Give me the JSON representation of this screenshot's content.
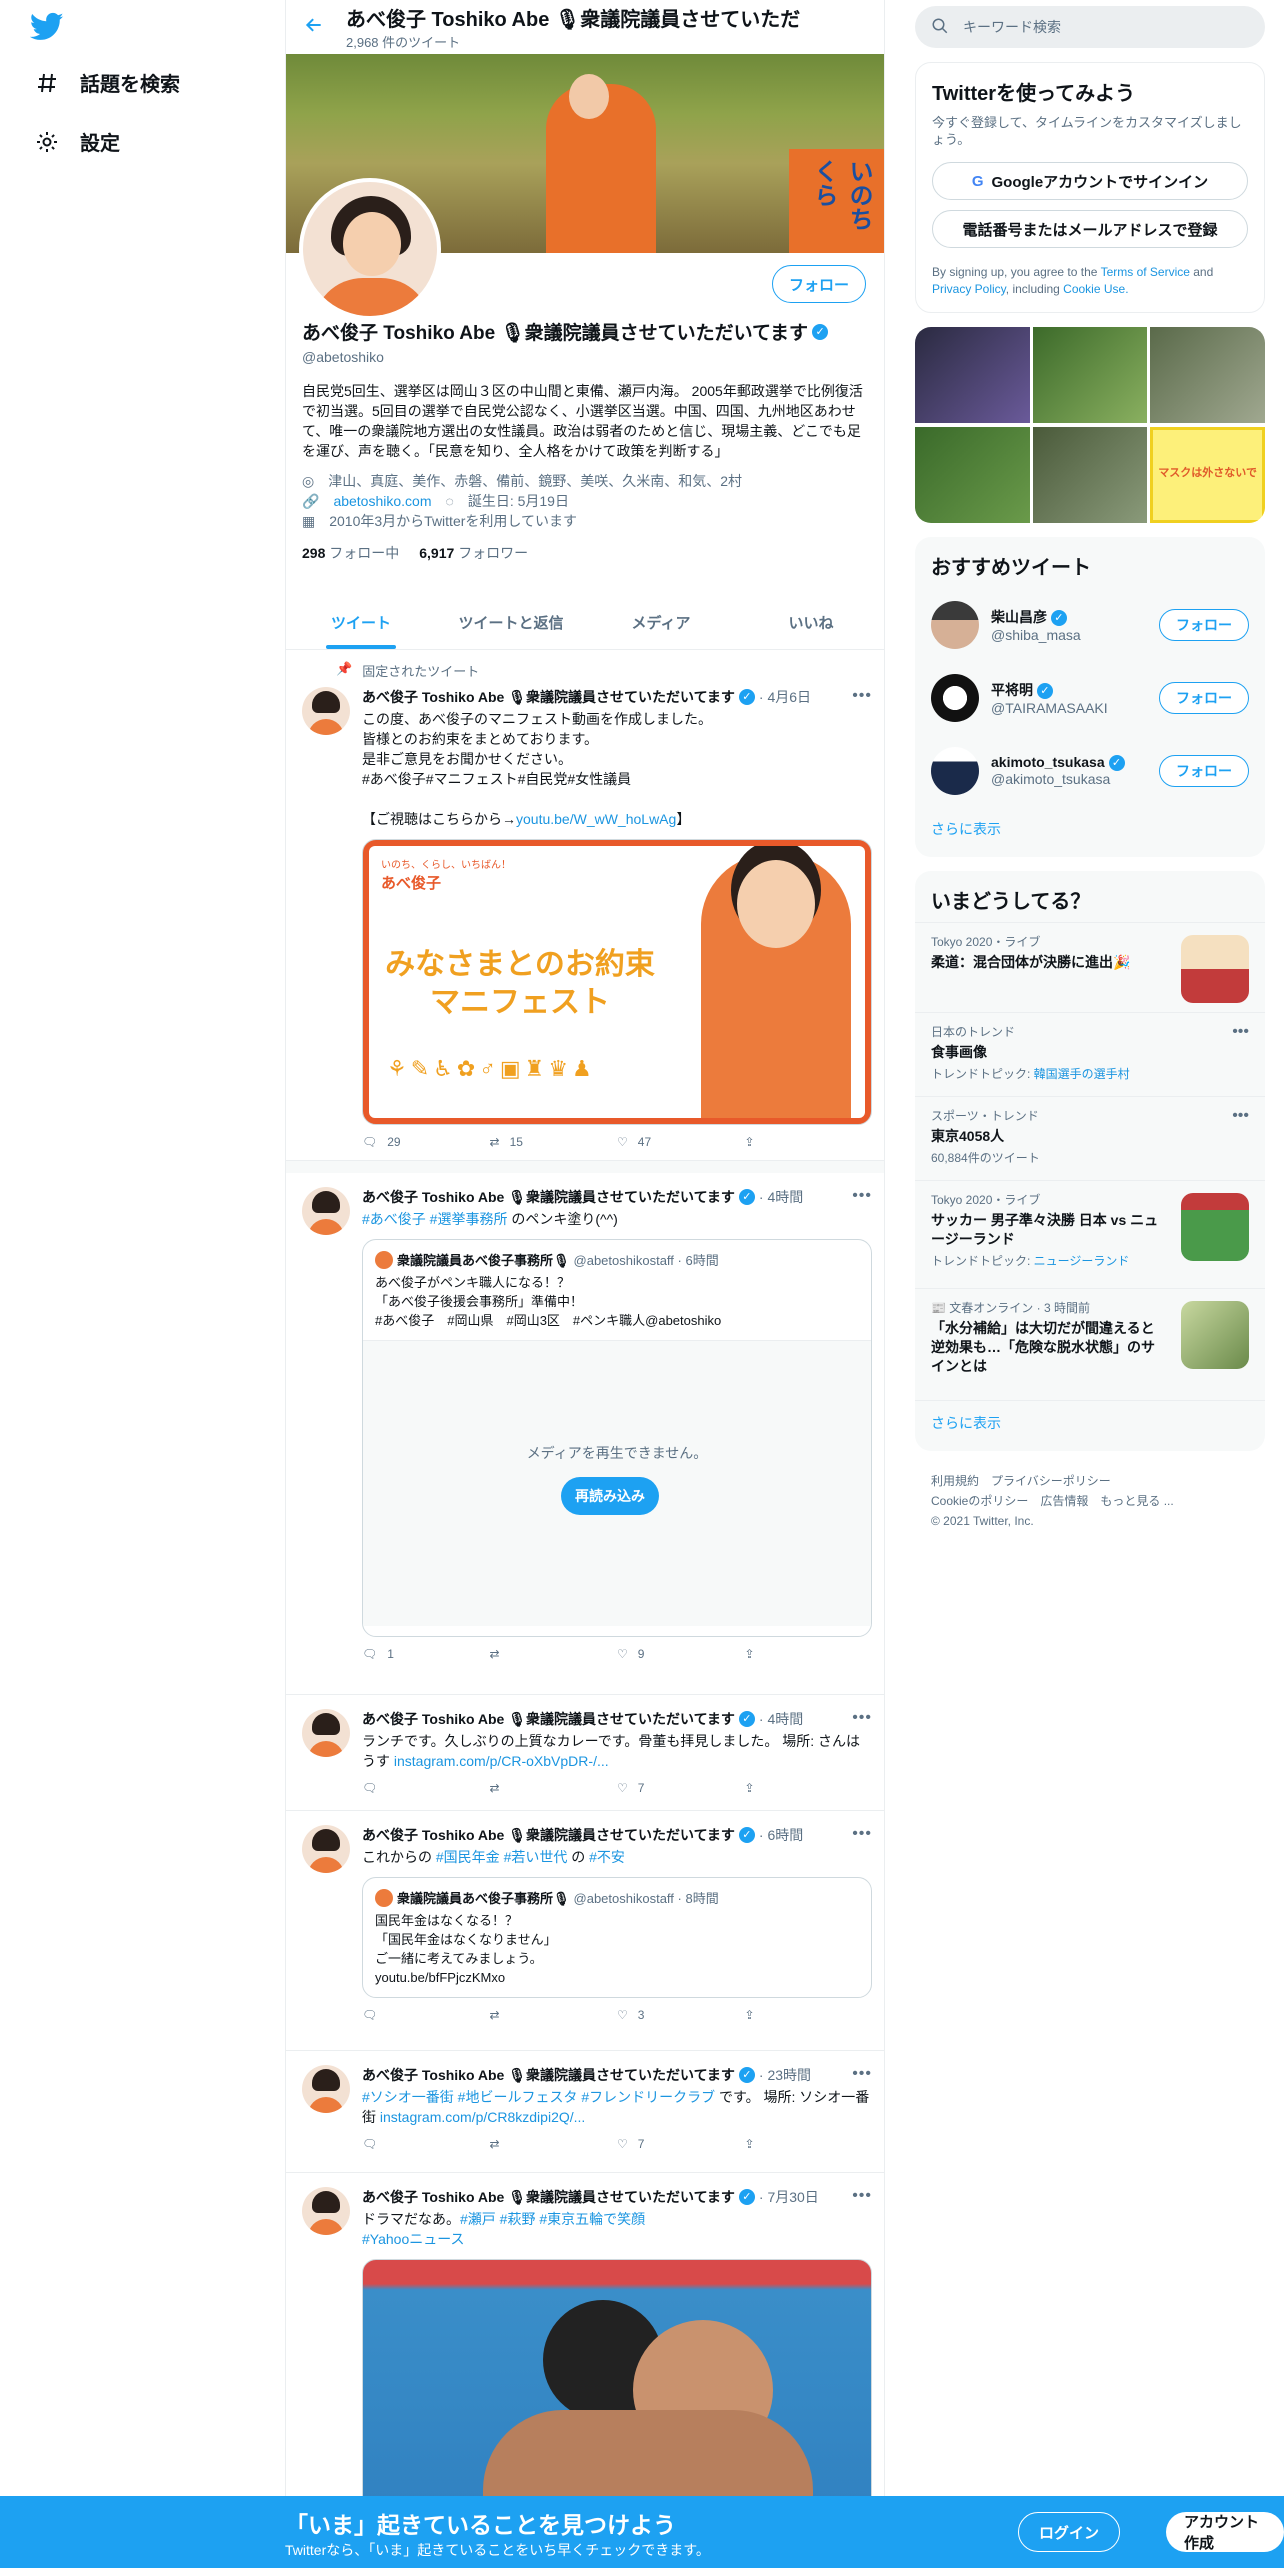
{
  "nav": {
    "explore": "話題を検索",
    "settings": "設定"
  },
  "header": {
    "title": "あべ俊子 Toshiko Abe 🎙衆議院議員させていただ",
    "tweet_count": "2,968 件のツイート"
  },
  "banner": {
    "sign_text": "いのちくら"
  },
  "profile": {
    "follow_label": "フォロー",
    "name": "あべ俊子 Toshiko Abe 🎙衆議院議員させていただいてます",
    "handle": "@abetoshiko",
    "bio": "自民党5回生、選挙区は岡山３区の中山間と東備、瀬戸内海。 2005年郵政選挙で比例復活で初当選。5回目の選挙で自民党公認なく、小選挙区当選。中国、四国、九州地区あわせて、唯一の衆議院地方選出の女性議員。政治は弱者のためと信じ、現場主義、どこでも足を運び、声を聴く。「民意を知り、全人格をかけて政策を判断する」",
    "location": "津山、真庭、美作、赤磐、備前、鏡野、美咲、久米南、和気、2村",
    "website": "abetoshiko.com",
    "birthday": "誕生日: 5月19日",
    "joined": "2010年3月からTwitterを利用しています",
    "following_count": "298",
    "following_label": "フォロー中",
    "followers_count": "6,917",
    "followers_label": "フォロワー"
  },
  "tabs": [
    "ツイート",
    "ツイートと返信",
    "メディア",
    "いいね"
  ],
  "tweets": [
    {
      "pinned": "固定されたツイート",
      "name": "あべ俊子 Toshiko Abe 🎙衆議院議員させていただいてます",
      "time": "· 4月6日",
      "text_lines": [
        "この度、あべ俊子のマニフェスト動画を作成しました。",
        "皆様とのお約束をまとめております。",
        "是非ご意見をお聞かせください。",
        "#あべ俊子#マニフェスト#自民党#女性議員",
        "",
        "【ご視聴はこちらから→"
      ],
      "link": "youtu.be/W_wW_hoLwAg",
      "link_tail": "】",
      "media_title": "みなさまとのお約束マニフェスト",
      "media_logo": "あべ俊子",
      "media_slogan": "いのち、くらし、いちばん！",
      "replies": "29",
      "retweets": "15",
      "likes": "47"
    },
    {
      "name": "あべ俊子 Toshiko Abe 🎙衆議院議員させていただいてます",
      "time": "· 4時間",
      "hashtags": "#あべ俊子 #選挙事務所",
      "text": " のペンキ塗り(^^)",
      "quote_name": "衆議院議員あべ俊子事務所🎙",
      "quote_handle": "@abetoshikostaff · 6時間",
      "quote_lines": [
        "あべ俊子がペンキ職人になる！？",
        "「あべ俊子後援会事務所」準備中！",
        "#あべ俊子　#岡山県　#岡山3区　#ペンキ職人@abetoshiko"
      ],
      "media_error": "メディアを再生できません。",
      "reload": "再読み込み",
      "replies": "1",
      "retweets": "",
      "likes": "9"
    },
    {
      "name": "あべ俊子 Toshiko Abe 🎙衆議院議員させていただいてます",
      "time": "· 4時間",
      "text": "ランチです。久しぶりの上質なカレーです。骨董も拝見しました。 場所: さんはうす ",
      "link": "instagram.com/p/CR-oXbVpDR-/...",
      "replies": "",
      "retweets": "",
      "likes": "7"
    },
    {
      "name": "あべ俊子 Toshiko Abe 🎙衆議院議員させていただいてます",
      "time": "· 6時間",
      "text_prefix": "これからの ",
      "hashtags": "#国民年金 #若い世代",
      "text_mid": " の ",
      "hashtag2": "#不安",
      "quote_name": "衆議院議員あべ俊子事務所🎙",
      "quote_handle": "@abetoshikostaff · 8時間",
      "quote_lines": [
        "国民年金はなくなる！？",
        "「国民年金はなくなりません」",
        "ご一緒に考えてみましょう。",
        "youtu.be/bfFPjczKMxo"
      ],
      "replies": "",
      "retweets": "",
      "likes": "3"
    },
    {
      "name": "あべ俊子 Toshiko Abe 🎙衆議院議員させていただいてます",
      "time": "· 23時間",
      "hashtags": "#ソシオ一番街 #地ビールフェスタ #フレンドリークラブ",
      "text": " です。 場所: ソシオ一番街 ",
      "link": "instagram.com/p/CR8kzdipi2Q/...",
      "replies": "",
      "retweets": "",
      "likes": "7"
    },
    {
      "name": "あべ俊子 Toshiko Abe 🎙衆議院議員させていただいてます",
      "time": "· 7月30日",
      "text": "ドラマだなあ。",
      "hashtags": "#瀬戸 #萩野 #東京五輪で笑顔",
      "hashtag2": "#Yahooニュース"
    }
  ],
  "right": {
    "search_placeholder": "キーワード検索",
    "signup_title": "Twitterを使ってみよう",
    "signup_sub": "今すぐ登録して、タイムラインをカスタマイズしましょう。",
    "google_btn": "Googleアカウントでサインイン",
    "phone_btn": "電話番号またはメールアドレスで登録",
    "terms_pre": "By signing up, you agree to the ",
    "terms_link": "Terms of Service",
    "terms_and": " and ",
    "privacy_link": "Privacy Policy",
    "terms_inc": ", including ",
    "cookie_link": "Cookie Use.",
    "poster_text": "マスクは外さないで",
    "suggest_title": "おすすめツイート",
    "suggestions": [
      {
        "name": "柴山昌彦",
        "handle": "@shiba_masa",
        "btn": "フォロー"
      },
      {
        "name": "平将明",
        "handle": "@TAIRAMASAAKI",
        "btn": "フォロー"
      },
      {
        "name": "akimoto_tsukasa",
        "handle": "@akimoto_tsukasa",
        "btn": "フォロー"
      }
    ],
    "show_more": "さらに表示",
    "trends_title": "いまどうしてる？",
    "trends": [
      {
        "cat": "Tokyo 2020・ライブ",
        "title": "柔道：混合団体が決勝に進出🎉",
        "sub": "",
        "img": "#c23b3b"
      },
      {
        "cat": "日本のトレンド",
        "title": "食事画像",
        "sub_pre": "トレンドトピック: ",
        "sub_link": "韓国選手の選手村",
        "img": ""
      },
      {
        "cat": "スポーツ・トレンド",
        "title": "東京4058人",
        "sub": "60,884件のツイート",
        "img": ""
      },
      {
        "cat": "Tokyo 2020・ライブ",
        "title": "サッカー 男子準々決勝 日本 vs ニュージーランド",
        "sub_pre": "トレンドトピック: ",
        "sub_link": "ニュージーランド",
        "img": "#4a9a4a"
      },
      {
        "cat": "文春オンライン · 3 時間前",
        "title": "「水分補給」は大切だが間違えると逆効果も…「危険な脱水状態」のサインとは",
        "sub": "",
        "img": "#9fb87a"
      }
    ],
    "footer_lines": [
      "利用規約　プライバシーポリシー",
      "Cookieのポリシー　広告情報　もっと見る ...",
      "© 2021 Twitter, Inc."
    ]
  },
  "bottom": {
    "title": "「いま」起きていることを見つけよう",
    "sub": "Twitterなら、「いま」起きていることをいち早くチェックできます。",
    "login": "ログイン",
    "signup": "アカウント作成"
  }
}
